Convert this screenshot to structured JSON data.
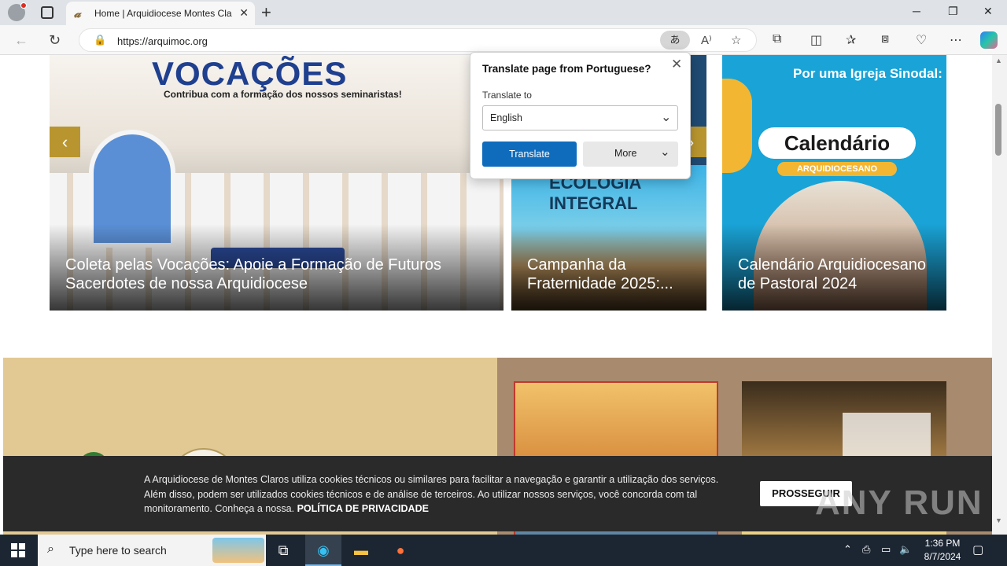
{
  "browser": {
    "tab_title": "Home | Arquidiocese Montes Cla",
    "url": "https://arquimoc.org",
    "translate_pill": "あ"
  },
  "translate_popup": {
    "title": "Translate page from Portuguese?",
    "label": "Translate to",
    "language": "English",
    "translate_button": "Translate",
    "more_button": "More"
  },
  "carousel": {
    "cards": [
      {
        "headline": "VOCAÇÕES",
        "subline": "Contribua com a formação dos nossos seminaristas!",
        "title": "Coleta pelas Vocações: Apoie a Formação de Futuros Sacerdotes de nossa Arquidiocese"
      },
      {
        "headline": "ECOLOGIA INTEGRAL",
        "title": "Campanha da Fraternidade 2025:..."
      },
      {
        "headline": "Calendário",
        "top_text": "Por uma Igreja Sinodal:",
        "subline": "ARQUIDIOCESANO",
        "title": "Calendário Arquidiocesano de Pastoral 2024"
      }
    ]
  },
  "cookie": {
    "text": "A Arquidiocese de Montes Claros utiliza cookies técnicos ou similares para facilitar a navegação e garantir a utilização dos serviços. Além disso, podem ser utilizados cookies técnicos e de análise de terceiros. Ao utilizar nossos serviços, você concorda com tal monitoramento. Conheça a nossa.",
    "policy_link": "POLÍTICA DE PRIVACIDADE",
    "button": "PROSSEGUIR"
  },
  "watermark": "ANY RUN",
  "taskbar": {
    "search_placeholder": "Type here to search",
    "time": "1:36 PM",
    "date": "8/7/2024"
  }
}
